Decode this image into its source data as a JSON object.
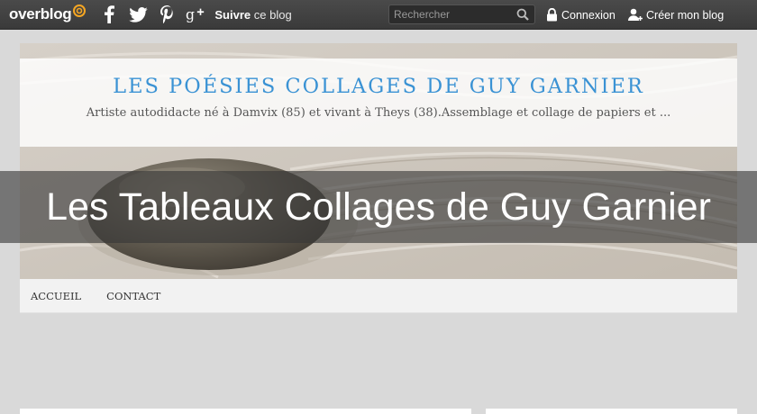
{
  "topbar": {
    "logo_text": "overblog",
    "social_icons": [
      "facebook-icon",
      "twitter-icon",
      "pinterest-icon",
      "google-plus-icon"
    ],
    "follow_bold": "Suivre",
    "follow_rest": " ce blog",
    "search_placeholder": "Rechercher",
    "login_label": "Connexion",
    "create_label": "Créer mon blog"
  },
  "header": {
    "title": "LES POÉSIES COLLAGES DE GUY GARNIER",
    "description": "Artiste autodidacte né à Damvix (85) et vivant à Theys (38).Assemblage et collage de papiers et ..."
  },
  "page_title": "Les Tableaux Collages de Guy Garnier",
  "nav": {
    "items": [
      {
        "label": "ACCUEIL"
      },
      {
        "label": "CONTACT"
      }
    ]
  },
  "colors": {
    "topbar": "#3f3f3f",
    "title_blue": "#3a92d4",
    "logo_orange": "#f5a623",
    "page_bg": "#d9d9d9"
  }
}
